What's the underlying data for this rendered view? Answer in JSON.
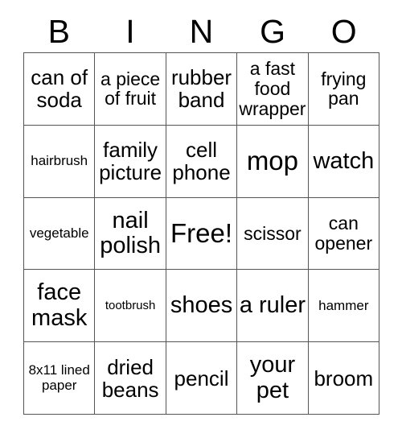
{
  "card": {
    "type": "bingo-card",
    "columns": 5,
    "rows": 5,
    "header": {
      "letters": [
        "B",
        "I",
        "N",
        "G",
        "O"
      ]
    },
    "grid": [
      [
        {
          "text": "can of soda",
          "size": "lg"
        },
        {
          "text": "a piece of fruit",
          "size": "md"
        },
        {
          "text": "rubber band",
          "size": "lg"
        },
        {
          "text": "a fast food wrapper",
          "size": "md"
        },
        {
          "text": "frying pan",
          "size": "md"
        }
      ],
      [
        {
          "text": "hairbrush",
          "size": "sm"
        },
        {
          "text": "family picture",
          "size": "lg"
        },
        {
          "text": "cell phone",
          "size": "lg"
        },
        {
          "text": "mop",
          "size": "xxl"
        },
        {
          "text": "watch",
          "size": "xl"
        }
      ],
      [
        {
          "text": "vegetable",
          "size": "sm"
        },
        {
          "text": "nail polish",
          "size": "xl"
        },
        {
          "text": "Free!",
          "size": "xxl"
        },
        {
          "text": "scissor",
          "size": "md"
        },
        {
          "text": "can opener",
          "size": "md"
        }
      ],
      [
        {
          "text": "face mask",
          "size": "xl"
        },
        {
          "text": "tootbrush",
          "size": "xs"
        },
        {
          "text": "shoes",
          "size": "xl"
        },
        {
          "text": "a ruler",
          "size": "xl"
        },
        {
          "text": "hammer",
          "size": "sm"
        }
      ],
      [
        {
          "text": "8x11 lined paper",
          "size": "sm"
        },
        {
          "text": "dried beans",
          "size": "lg"
        },
        {
          "text": "pencil",
          "size": "lg"
        },
        {
          "text": "your pet",
          "size": "xl"
        },
        {
          "text": "broom",
          "size": "lg"
        }
      ]
    ]
  },
  "colors": {
    "background": "#ffffff",
    "text": "#000000",
    "grid_line": "#555555"
  }
}
